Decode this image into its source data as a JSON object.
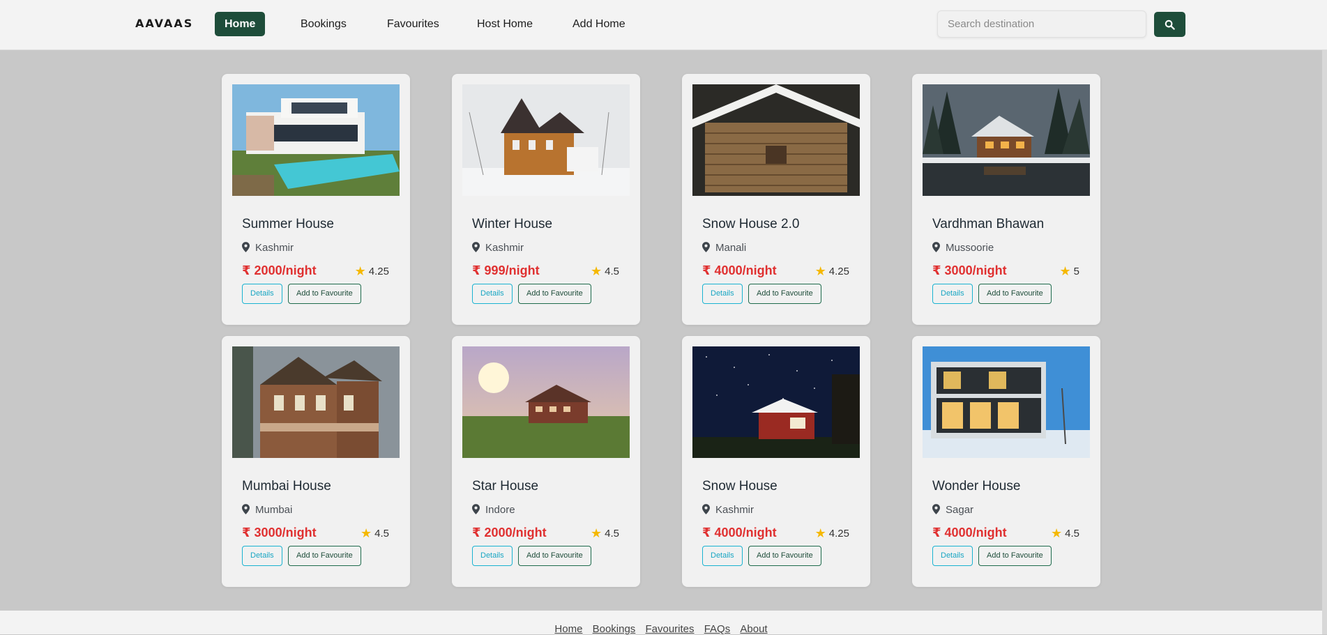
{
  "brand": "AAVAAS",
  "nav": [
    {
      "label": "Home",
      "active": true
    },
    {
      "label": "Bookings",
      "active": false
    },
    {
      "label": "Favourites",
      "active": false
    },
    {
      "label": "Host Home",
      "active": false
    },
    {
      "label": "Add Home",
      "active": false
    }
  ],
  "search": {
    "placeholder": "Search destination",
    "button_icon": "search-icon"
  },
  "listings": [
    {
      "title": "Summer House",
      "location": "Kashmir",
      "price": "2000/night",
      "rating": "4.25",
      "image": "modern-villa-pool"
    },
    {
      "title": "Winter House",
      "location": "Kashmir",
      "price": "999/night",
      "rating": "4.5",
      "image": "victorian-house-snow"
    },
    {
      "title": "Snow House 2.0",
      "location": "Manali",
      "price": "4000/night",
      "rating": "4.25",
      "image": "log-cabin-snow"
    },
    {
      "title": "Vardhman Bhawan",
      "location": "Mussoorie",
      "price": "3000/night",
      "rating": "5",
      "image": "forest-lake-lodge"
    },
    {
      "title": "Mumbai House",
      "location": "Mumbai",
      "price": "3000/night",
      "rating": "4.5",
      "image": "victorian-mansion"
    },
    {
      "title": "Star House",
      "location": "Indore",
      "price": "2000/night",
      "rating": "4.5",
      "image": "farmhouse-sunset"
    },
    {
      "title": "Snow House",
      "location": "Kashmir",
      "price": "4000/night",
      "rating": "4.25",
      "image": "red-cabin-night"
    },
    {
      "title": "Wonder House",
      "location": "Sagar",
      "price": "4000/night",
      "rating": "4.5",
      "image": "glass-house-snow"
    }
  ],
  "card_buttons": {
    "details": "Details",
    "favourite": "Add to Favourite"
  },
  "currency_symbol": "₹",
  "footer": [
    "Home",
    "Bookings",
    "Favourites",
    "FAQs",
    "About"
  ],
  "colors": {
    "primary": "#1e4d3a",
    "price": "#e03131",
    "star": "#f5b800",
    "details_border": "#19b3d1"
  }
}
